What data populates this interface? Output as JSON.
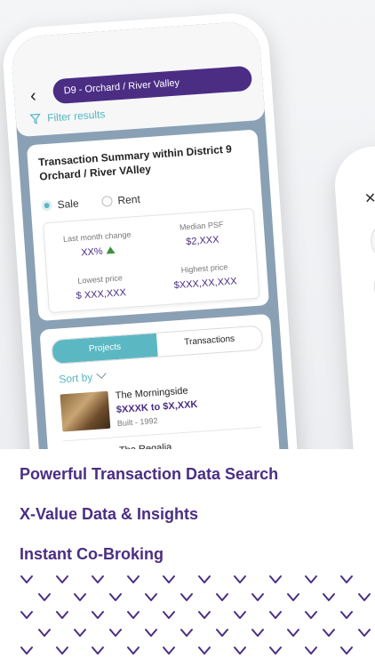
{
  "header": {
    "district_label": "D9 - Orchard / River Valley",
    "filter_label": "Filter results"
  },
  "summary": {
    "title": "Transaction Summary within District 9 Orchard / River VAlley",
    "options": [
      "Sale",
      "Rent"
    ],
    "selected_option": "Sale",
    "stats": {
      "last_month_change_label": "Last month change",
      "last_month_change_value": "XX%",
      "median_psf_label": "Median PSF",
      "median_psf_value": "$2,XXX",
      "lowest_price_label": "Lowest price",
      "lowest_price_value": "$ XXX,XXX",
      "highest_price_label": "Highest price",
      "highest_price_value": "$XXX,XX,XXX"
    }
  },
  "list": {
    "tabs": [
      "Projects",
      "Transactions"
    ],
    "active_tab": "Projects",
    "sort_label": "Sort by",
    "items": [
      {
        "name": "The Morningside",
        "price": "$XXXK to $X,XXK",
        "built": "Built - 1992"
      },
      {
        "name": "The Regalia"
      }
    ]
  },
  "features": [
    "Powerful Transaction Data Search",
    "X-Value Data & Insights",
    "Instant Co-Broking"
  ],
  "colors": {
    "brand_purple": "#4b2d84",
    "accent_teal": "#5bb8c3",
    "increase_green": "#3f8f3f"
  },
  "icons": [
    "back-arrow-icon",
    "filter-icon",
    "chevron-down-icon",
    "trend-up-icon",
    "close-icon"
  ]
}
